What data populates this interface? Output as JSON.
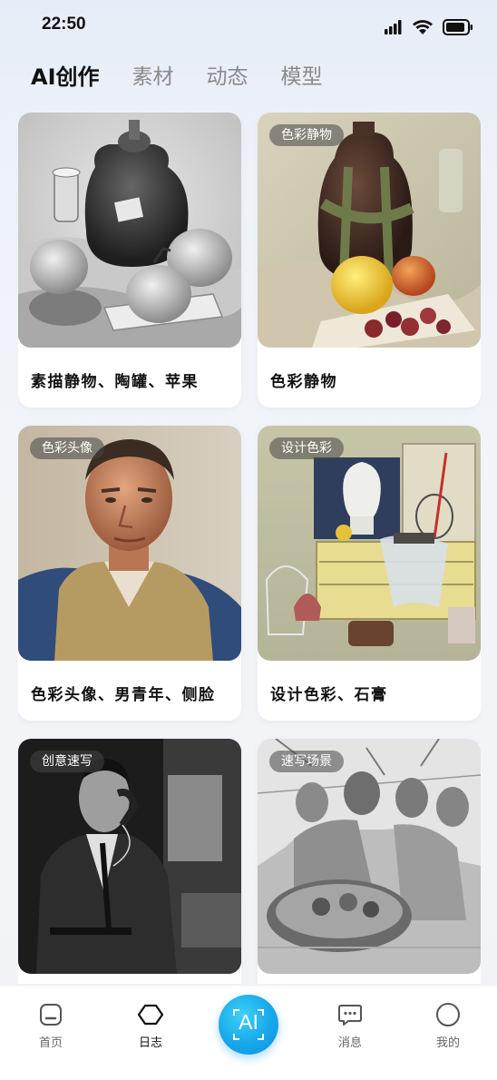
{
  "status_bar": {
    "time": "22:50"
  },
  "tabs": [
    {
      "label": "AI创作",
      "active": true
    },
    {
      "label": "素材",
      "active": false
    },
    {
      "label": "动态",
      "active": false
    },
    {
      "label": "模型",
      "active": false
    }
  ],
  "cards": [
    {
      "tag": "",
      "title": "素描静物、陶罐、苹果"
    },
    {
      "tag": "色彩静物",
      "title": "色彩静物"
    },
    {
      "tag": "色彩头像",
      "title": "色彩头像、男青年、侧脸"
    },
    {
      "tag": "设计色彩",
      "title": "设计色彩、石膏"
    },
    {
      "tag": "创意速写",
      "title": ""
    },
    {
      "tag": "速写场景",
      "title": ""
    }
  ],
  "bottom_nav": {
    "items": [
      {
        "label": "首页",
        "icon": "home-icon"
      },
      {
        "label": "日志",
        "icon": "hexagon-icon"
      },
      {
        "label": "消息",
        "icon": "message-icon"
      },
      {
        "label": "我的",
        "icon": "profile-icon"
      }
    ],
    "ai_label": "AI",
    "accent_color": "#17a7ea"
  }
}
